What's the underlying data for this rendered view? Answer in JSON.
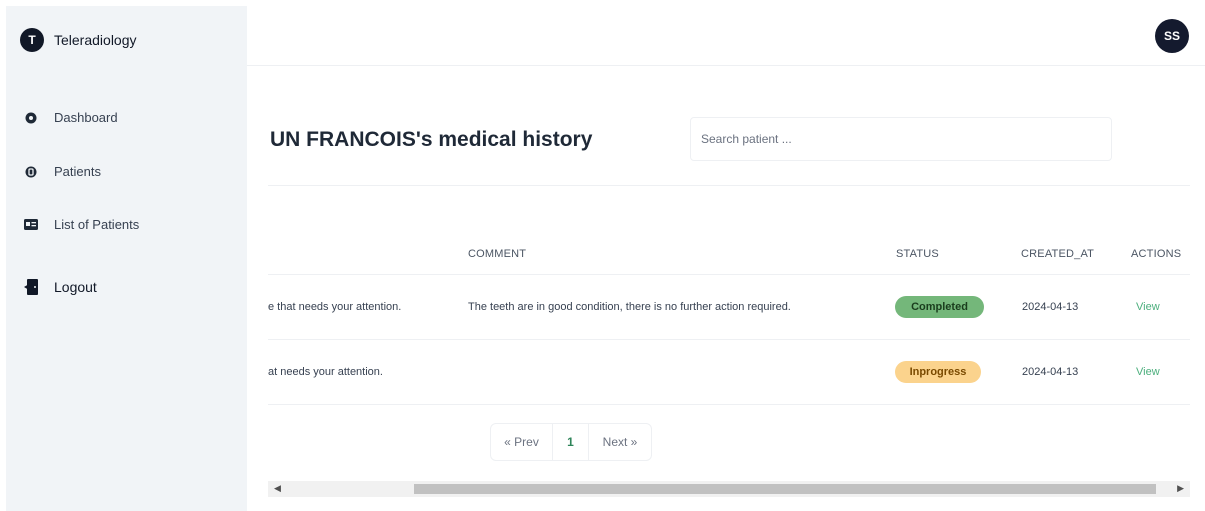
{
  "sidebar": {
    "brand_initial": "T",
    "brand_name": "Teleradiology",
    "items": [
      {
        "label": "Dashboard",
        "icon": "dashboard-icon"
      },
      {
        "label": "Patients",
        "icon": "patients-icon"
      },
      {
        "label": "List of Patients",
        "icon": "id-card-icon"
      }
    ],
    "logout_label": "Logout"
  },
  "header": {
    "avatar_initials": "SS"
  },
  "main": {
    "title": "UN FRANCOIS's medical history",
    "search_placeholder": "Search patient ...",
    "table": {
      "columns": [
        "COMMENT",
        "STATUS",
        "CREATED_AT",
        "ACTIONS"
      ],
      "rows": [
        {
          "description": "e that needs your attention.",
          "comment": "The teeth are in good condition, there is no further action required.",
          "status": "Completed",
          "created_at": "2024-04-13",
          "action": "View"
        },
        {
          "description": "at needs your attention.",
          "comment": "",
          "status": "Inprogress",
          "created_at": "2024-04-13",
          "action": "View"
        }
      ]
    },
    "pagination": {
      "prev": "« Prev",
      "page": "1",
      "next": "Next »"
    }
  },
  "colors": {
    "sidebar_bg": "#f1f4f7",
    "completed_badge": "#74b77a",
    "inprogress_badge": "#fbd38d",
    "link": "#4caf7d",
    "avatar_bg": "#141a2e"
  }
}
